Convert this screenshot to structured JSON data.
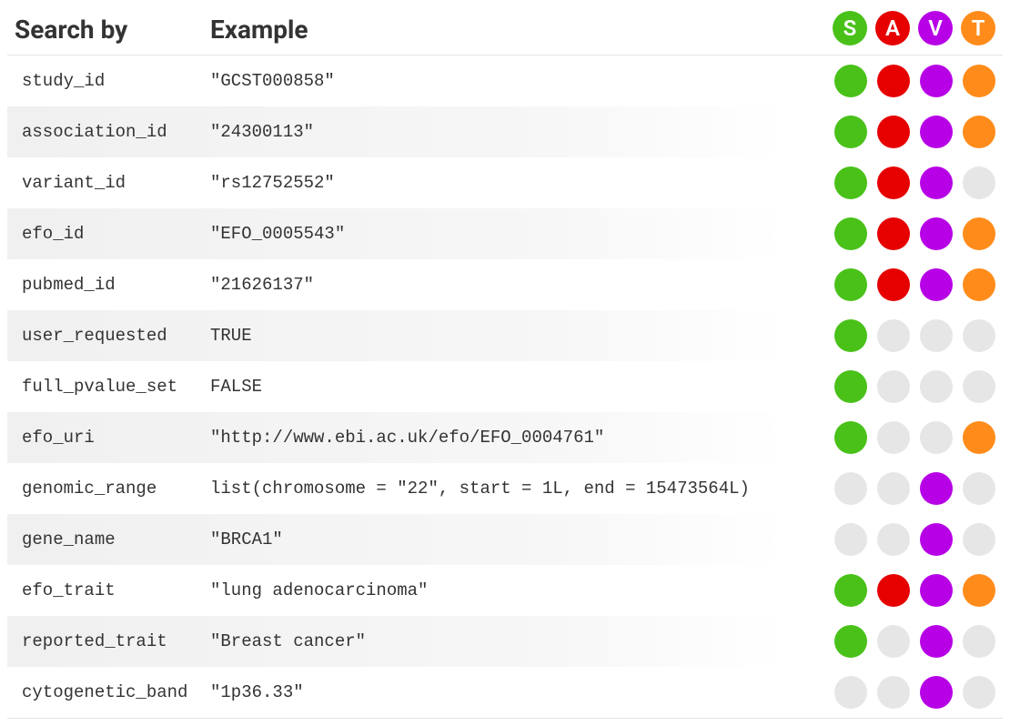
{
  "colors": {
    "S": "#49c119",
    "A": "#e60000",
    "V": "#b700e6",
    "T": "#ff8c1a",
    "off": "#e6e6e6"
  },
  "headers": {
    "search_by": "Search by",
    "example": "Example",
    "badges": [
      "S",
      "A",
      "V",
      "T"
    ]
  },
  "rows": [
    {
      "search_by": "study_id",
      "example": "\"GCST000858\"",
      "dots": [
        true,
        true,
        true,
        true
      ]
    },
    {
      "search_by": "association_id",
      "example": "\"24300113\"",
      "dots": [
        true,
        true,
        true,
        true
      ]
    },
    {
      "search_by": "variant_id",
      "example": "\"rs12752552\"",
      "dots": [
        true,
        true,
        true,
        false
      ]
    },
    {
      "search_by": "efo_id",
      "example": "\"EFO_0005543\"",
      "dots": [
        true,
        true,
        true,
        true
      ]
    },
    {
      "search_by": "pubmed_id",
      "example": "\"21626137\"",
      "dots": [
        true,
        true,
        true,
        true
      ]
    },
    {
      "search_by": "user_requested",
      "example": "TRUE",
      "dots": [
        true,
        false,
        false,
        false
      ]
    },
    {
      "search_by": "full_pvalue_set",
      "example": "FALSE",
      "dots": [
        true,
        false,
        false,
        false
      ]
    },
    {
      "search_by": "efo_uri",
      "example": "\"http://www.ebi.ac.uk/efo/EFO_0004761\"",
      "dots": [
        true,
        false,
        false,
        true
      ]
    },
    {
      "search_by": "genomic_range",
      "example": "list(chromosome = \"22\", start = 1L, end = 15473564L)",
      "dots": [
        false,
        false,
        true,
        false
      ]
    },
    {
      "search_by": "gene_name",
      "example": "\"BRCA1\"",
      "dots": [
        false,
        false,
        true,
        false
      ]
    },
    {
      "search_by": "efo_trait",
      "example": "\"lung adenocarcinoma\"",
      "dots": [
        true,
        true,
        true,
        true
      ]
    },
    {
      "search_by": "reported_trait",
      "example": "\"Breast cancer\"",
      "dots": [
        true,
        false,
        true,
        false
      ]
    },
    {
      "search_by": "cytogenetic_band",
      "example": "\"1p36.33\"",
      "dots": [
        false,
        false,
        true,
        false
      ]
    }
  ]
}
